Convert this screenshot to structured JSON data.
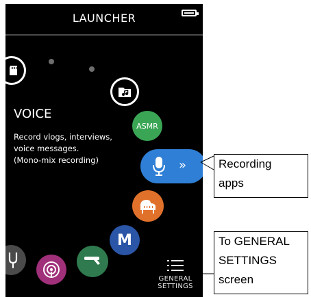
{
  "header": {
    "title": "LAUNCHER"
  },
  "status": {
    "battery_icon": "battery-icon"
  },
  "mode": {
    "title": "VOICE",
    "description": "Record vlogs, interviews,\nvoice messages.\n(Mono-mix recording)"
  },
  "apps": {
    "sd_card": {
      "icon": "sd-card-icon"
    },
    "music_folder": {
      "icon": "music-folder-icon"
    },
    "asmr": {
      "label": "ASMR"
    },
    "voice": {
      "icon": "microphone-icon",
      "chevron": "»"
    },
    "piano": {
      "icon": "piano-icon"
    },
    "manual": {
      "label": "M"
    },
    "field": {
      "icon": "shotgun-mic-icon"
    },
    "podcast": {
      "icon": "podcast-icon"
    },
    "tuner": {
      "icon": "tuning-fork-icon"
    }
  },
  "general_settings": {
    "icon": "menu-icon",
    "label": "GENERAL\nSETTINGS"
  },
  "callouts": {
    "recording_apps": "Recording\napps",
    "general_settings": "To GENERAL\nSETTINGS\nscreen"
  },
  "colors": {
    "voice": "#2f7fd6",
    "asmr": "#3aa655",
    "piano": "#e0712b",
    "manual": "#2b55a6",
    "field": "#2f7a4e",
    "podcast": "#a0307a",
    "tuner": "#4a4a4a",
    "screen_bg": "#000000"
  }
}
